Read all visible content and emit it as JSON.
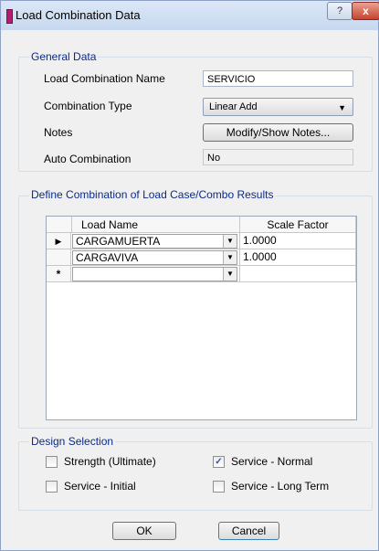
{
  "window": {
    "title": "Load Combination Data",
    "help_label": "?",
    "close_label": "x"
  },
  "general": {
    "label": "General Data",
    "name_label": "Load Combination Name",
    "name_value": "SERVICIO",
    "type_label": "Combination Type",
    "type_value": "Linear Add",
    "notes_label": "Notes",
    "notes_button": "Modify/Show Notes...",
    "auto_label": "Auto Combination",
    "auto_value": "No"
  },
  "define": {
    "label": "Define Combination of Load Case/Combo Results",
    "columns": [
      "Load Name",
      "Scale Factor"
    ],
    "rows": [
      {
        "marker": "▶",
        "load_name": "CARGAMUERTA",
        "scale_factor": "1.0000"
      },
      {
        "marker": "",
        "load_name": "CARGAVIVA",
        "scale_factor": "1.0000"
      },
      {
        "marker": "*",
        "load_name": "",
        "scale_factor": ""
      }
    ]
  },
  "design": {
    "label": "Design Selection",
    "options": [
      {
        "label": "Strength (Ultimate)",
        "checked": false
      },
      {
        "label": "Service - Normal",
        "checked": true
      },
      {
        "label": "Service - Initial",
        "checked": false
      },
      {
        "label": "Service - Long Term",
        "checked": false
      }
    ]
  },
  "buttons": {
    "ok": "OK",
    "cancel": "Cancel"
  },
  "icons": {
    "dropdown": "chevron-down-icon",
    "check": "checkmark-icon",
    "row_pointer": "row-pointer-icon"
  }
}
